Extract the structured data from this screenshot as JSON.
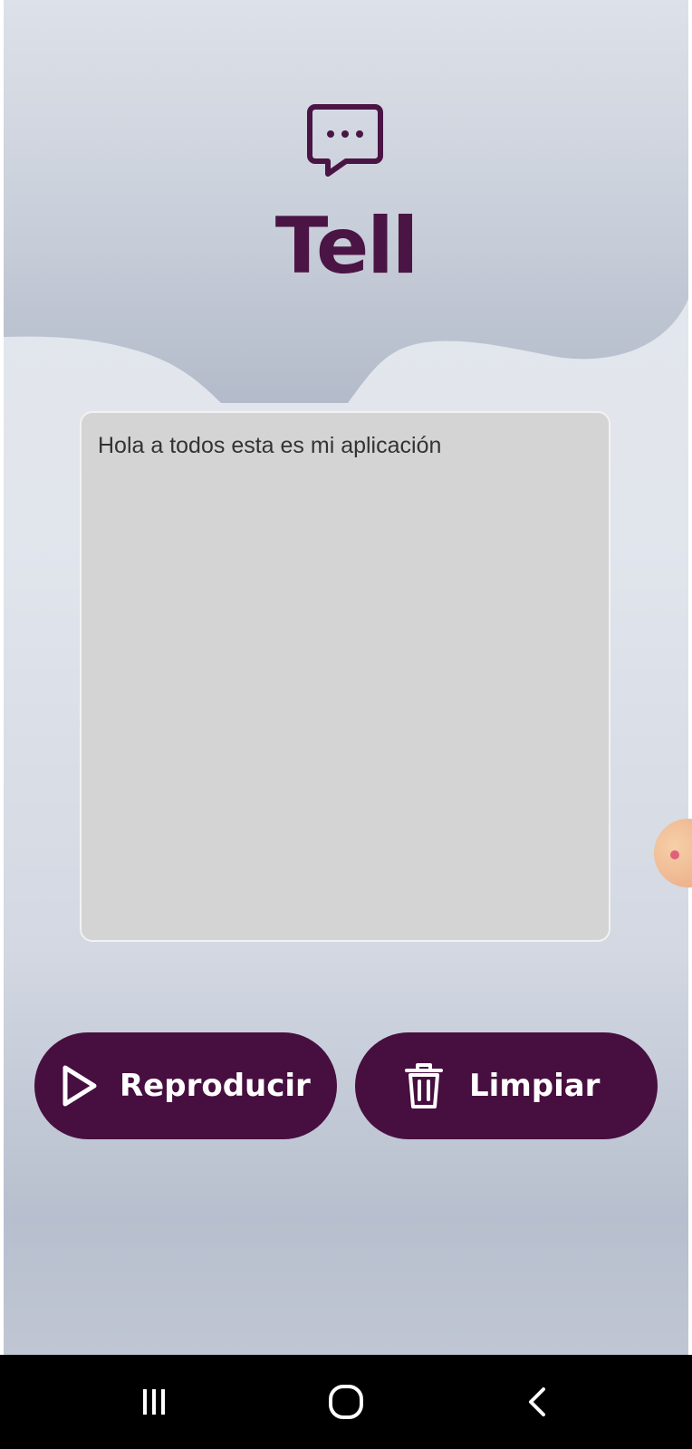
{
  "app": {
    "title": "Tell",
    "logo_icon": "chat-bubble-ellipsis-icon",
    "accent_color": "#4a1545"
  },
  "text_area": {
    "value": "Hola a todos esta es mi aplicación",
    "background": "#d4d4d4"
  },
  "buttons": {
    "play": {
      "label": "Reproducir",
      "icon": "play-icon"
    },
    "clear": {
      "label": "Limpiar",
      "icon": "trash-icon"
    },
    "color": "#470f3f"
  },
  "nav_bar": {
    "recents_icon": "recent-apps-icon",
    "home_icon": "home-icon",
    "back_icon": "back-icon"
  }
}
